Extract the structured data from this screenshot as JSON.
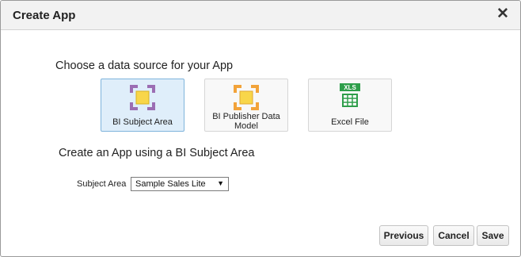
{
  "dialog": {
    "title": "Create App",
    "close_glyph": "✕"
  },
  "datasource": {
    "heading": "Choose a data source for your App",
    "cards": [
      {
        "label": "BI Subject Area",
        "icon": "subject-area-icon",
        "icon_color": "#9b6db3",
        "selected": true
      },
      {
        "label": "BI Publisher Data Model",
        "icon": "data-model-icon",
        "icon_color": "#f2a33a",
        "selected": false
      },
      {
        "label": "Excel File",
        "icon": "excel-icon",
        "icon_badge": "XLS",
        "icon_color": "#2e9e4a",
        "selected": false
      }
    ]
  },
  "create": {
    "heading": "Create an App using a BI Subject Area",
    "subject_area_label": "Subject Area",
    "subject_area_value": "Sample Sales Lite",
    "dropdown_arrow": "▼"
  },
  "buttons": {
    "previous": "Previous",
    "cancel": "Cancel",
    "save": "Save"
  },
  "colors": {
    "selected_card_bg": "#dfeefa",
    "selected_card_border": "#7fb4dc",
    "yellow_center": "#f8d64a"
  }
}
